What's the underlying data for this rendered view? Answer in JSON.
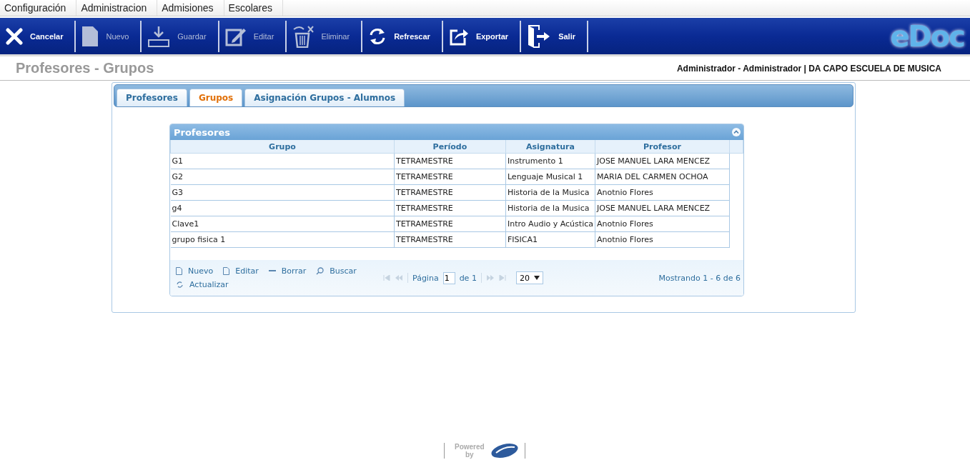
{
  "menu": [
    {
      "label": "Configuración"
    },
    {
      "label": "Administracion"
    },
    {
      "label": "Admisiones"
    },
    {
      "label": "Escolares"
    }
  ],
  "toolbar": [
    {
      "label": "Cancelar",
      "kind": "cancel",
      "disabled": false
    },
    {
      "label": "Nuevo",
      "kind": "new",
      "disabled": true
    },
    {
      "label": "Guardar",
      "kind": "save",
      "disabled": true
    },
    {
      "label": "Editar",
      "kind": "edit",
      "disabled": true
    },
    {
      "label": "Eliminar",
      "kind": "delete",
      "disabled": true
    },
    {
      "label": "Refrescar",
      "kind": "refresh",
      "disabled": false
    },
    {
      "label": "Exportar",
      "kind": "export",
      "disabled": false
    },
    {
      "label": "Salir",
      "kind": "exit",
      "disabled": false
    }
  ],
  "logo": "eDoc",
  "page_title": "Profesores - Grupos",
  "user_info": "Administrador - Administrador | DA CAPO ESCUELA DE MUSICA",
  "tabs": [
    {
      "label": "Profesores",
      "selected": false
    },
    {
      "label": "Grupos",
      "selected": true
    },
    {
      "label": "Asignación Grupos - Alumnos",
      "selected": false
    }
  ],
  "grid": {
    "title": "Profesores",
    "columns": [
      "Grupo",
      "Período",
      "Asignatura",
      "Profesor"
    ],
    "rows": [
      [
        "G1",
        "TETRAMESTRE",
        "Instrumento 1",
        "JOSE MANUEL LARA MENCEZ"
      ],
      [
        "G2",
        "TETRAMESTRE",
        "Lenguaje Musical 1",
        "MARIA DEL CARMEN OCHOA"
      ],
      [
        "G3",
        "TETRAMESTRE",
        "Historia de la Musica",
        "Anotnio Flores"
      ],
      [
        "g4",
        "TETRAMESTRE",
        "Historia de la Musica",
        "JOSE MANUEL LARA MENCEZ"
      ],
      [
        "Clave1",
        "TETRAMESTRE",
        "Intro Audio y Acústica",
        "Anotnio Flores"
      ],
      [
        "grupo fisica 1",
        "TETRAMESTRE",
        "FISICA1",
        "Anotnio Flores"
      ]
    ],
    "actions": [
      {
        "label": "Nuevo",
        "kind": "new"
      },
      {
        "label": "Editar",
        "kind": "edit"
      },
      {
        "label": "Borrar",
        "kind": "delete"
      },
      {
        "label": "Buscar",
        "kind": "search"
      },
      {
        "label": "Actualizar",
        "kind": "refresh"
      }
    ],
    "pager": {
      "page_label": "Página",
      "page": "1",
      "of_label": "de 1",
      "page_size": "20",
      "summary": "Mostrando 1 - 6 de 6"
    }
  },
  "footer": {
    "powered": "Powered",
    "by": "by"
  }
}
